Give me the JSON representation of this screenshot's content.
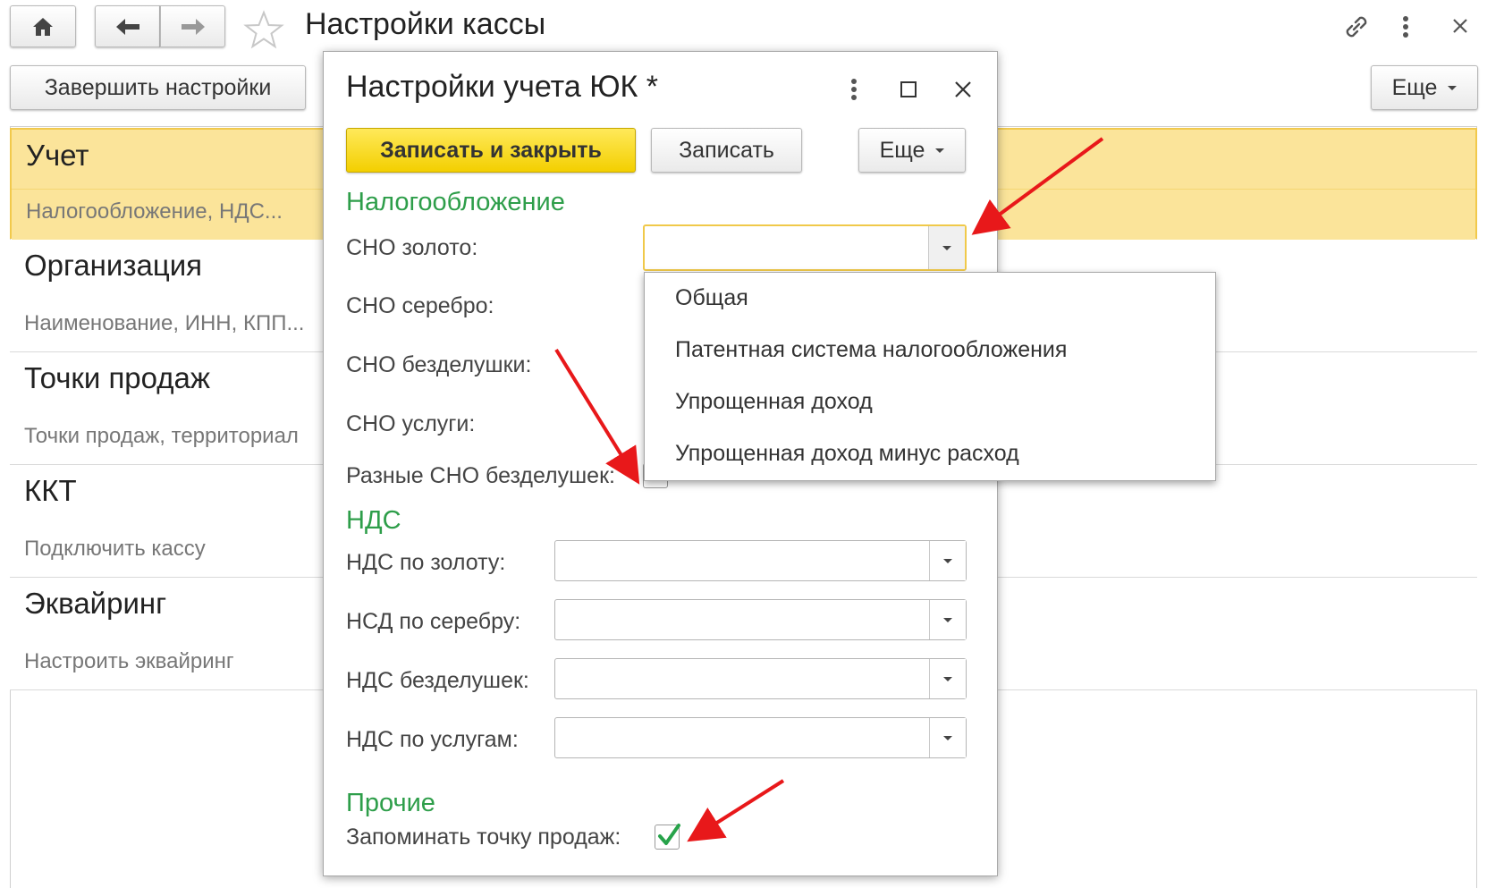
{
  "window": {
    "title": "Настройки кассы",
    "home_icon": "home-icon",
    "back_icon": "arrow-left-icon",
    "forward_icon": "arrow-right-icon",
    "favorite_icon": "star-icon",
    "link_icon": "link-icon",
    "menu_icon": "more-vertical-icon",
    "close_icon": "close-icon"
  },
  "toolbar": {
    "finish_label": "Завершить настройки",
    "more_label": "Еще"
  },
  "sections": [
    {
      "title": "Учет",
      "subtitle": "Налогообложение, НДС...",
      "active": true
    },
    {
      "title": "Организация",
      "subtitle": "Наименование, ИНН, КПП..."
    },
    {
      "title": "Точки продаж",
      "subtitle": "Точки продаж, территориал"
    },
    {
      "title": "ККТ",
      "subtitle": "Подключить кассу"
    },
    {
      "title": "Эквайринг",
      "subtitle": "Настроить эквайринг"
    }
  ],
  "dialog": {
    "title": "Настройки учета ЮК *",
    "save_close_label": "Записать и закрыть",
    "save_label": "Записать",
    "more_label": "Еще",
    "group_tax": "Налогообложение",
    "sno_gold": "СНО золото:",
    "sno_silver": "СНО серебро:",
    "sno_trinkets": "СНО безделушки:",
    "sno_services": "СНО услуги:",
    "different_sno": "Разные СНО безделушек:",
    "group_vat": "НДС",
    "vat_gold": "НДС по золоту:",
    "vat_silver": "НСД по серебру:",
    "vat_trinkets": "НДС безделушек:",
    "vat_services": "НДС по услугам:",
    "group_other": "Прочие",
    "remember_point": "Запоминать точку продаж:",
    "remember_point_checked": true,
    "different_sno_checked": false
  },
  "dropdown": {
    "options": [
      "Общая",
      "Патентная система налогообложения",
      "Упрощенная доход",
      "Упрощенная доход минус расход"
    ]
  },
  "colors": {
    "accent_green": "#2e9e4a",
    "highlight_yellow": "#fbe49a",
    "button_yellow": "#f3cf00",
    "annotation_red": "#e8181a"
  }
}
